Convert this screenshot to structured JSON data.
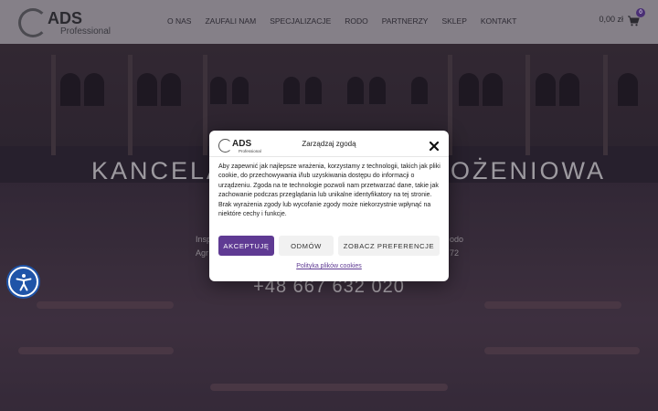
{
  "header": {
    "logo_text": "ADS",
    "logo_subtext": "Professional",
    "nav": [
      "O NAS",
      "ZAUFALI NAM",
      "SPECJALIZACJE",
      "RODO",
      "PARTNERZY",
      "SKLEP",
      "KONTAKT"
    ],
    "cart_price": "0,00 zł",
    "cart_count": "0"
  },
  "hero": {
    "title_left": "KANCELAR",
    "title_right": "OŻENIOWA",
    "line1_left": "Insp",
    "line1_right": "odo",
    "line2_left": "Agr",
    "line2_right": "72",
    "phone": "+48 667 632 020"
  },
  "consent": {
    "logo_text": "ADS",
    "logo_subtext": "Professional",
    "title": "Zarządzaj zgodą",
    "body": "Aby zapewnić jak najlepsze wrażenia, korzystamy z technologii, takich jak pliki cookie, do przechowywania i/lub uzyskiwania dostępu do informacji o urządzeniu. Zgoda na te technologie pozwoli nam przetwarzać dane, takie jak zachowanie podczas przeglądania lub unikalne identyfikatory na tej stronie. Brak wyrażenia zgody lub wycofanie zgody może niekorzystnie wpłynąć na niektóre cechy i funkcje.",
    "accept_label": "AKCEPTUJĘ",
    "deny_label": "ODMÓW",
    "prefs_label": "ZOBACZ PREFERENCJE",
    "policy_link": "Polityka plików cookies"
  },
  "colors": {
    "accent": "#5f3a93",
    "header_bg": "#858088",
    "a11y_button": "#1f54a8"
  },
  "icons": [
    "cart-icon",
    "close-icon",
    "accessibility-icon"
  ]
}
